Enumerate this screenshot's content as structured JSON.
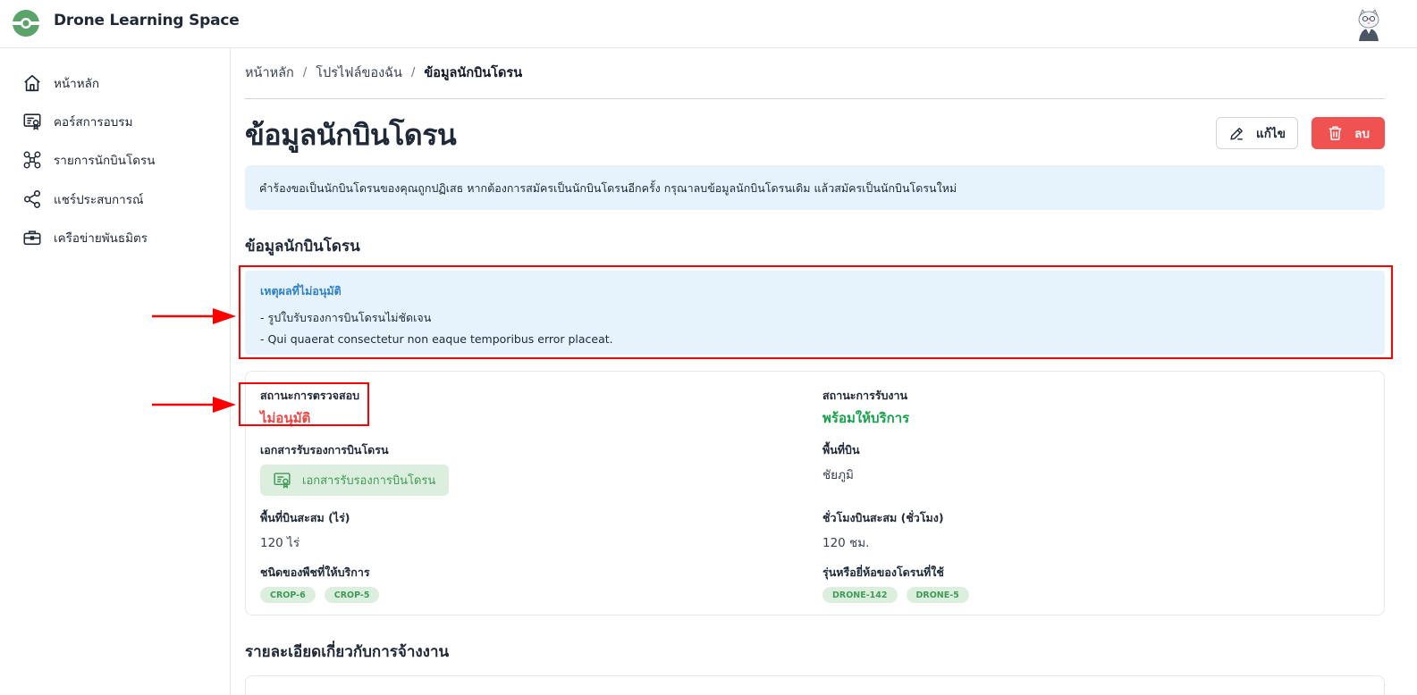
{
  "app": {
    "title": "Drone Learning Space"
  },
  "sidebar": {
    "items": [
      {
        "label": "หน้าหลัก",
        "icon": "home-icon"
      },
      {
        "label": "คอร์สการอบรม",
        "icon": "certificate-icon"
      },
      {
        "label": "รายการนักบินโดรน",
        "icon": "drone-icon"
      },
      {
        "label": "แชร์ประสบการณ์",
        "icon": "share-icon"
      },
      {
        "label": "เครือข่ายพันธมิตร",
        "icon": "briefcase-icon"
      }
    ]
  },
  "breadcrumb": {
    "items": [
      "หน้าหลัก",
      "โปรไฟล์ของฉัน"
    ],
    "separator": "/",
    "current": "ข้อมูลนักบินโดรน"
  },
  "page": {
    "title": "ข้อมูลนักบินโดรน",
    "edit_label": "แก้ไข",
    "delete_label": "ลบ",
    "alert": "คำร้องขอเป็นนักบินโดรนของคุณถูกปฏิเสธ หากต้องการสมัครเป็นนักบินโดรนอีกครั้ง กรุณาลบข้อมูลนักบินโดรนเดิม แล้วสมัครเป็นนักบินโดรนใหม่"
  },
  "section": {
    "pilot_info_title": "ข้อมูลนักบินโดรน",
    "employment_title": "รายละเอียดเกี่ยวกับการจ้างงาน"
  },
  "rejection": {
    "title": "เหตุผลที่ไม่อนุมัติ",
    "reasons": [
      "- รูปใบรับรองการบินโดรนไม่ชัดเจน",
      "- Qui quaerat consectetur non eaque temporibus error placeat."
    ]
  },
  "details": {
    "verification_status": {
      "label": "สถานะการตรวจสอบ",
      "value": "ไม่อนุมัติ"
    },
    "work_status": {
      "label": "สถานะการรับงาน",
      "value": "พร้อมให้บริการ"
    },
    "certificate": {
      "label": "เอกสารรับรองการบินโดรน",
      "button": "เอกสารรับรองการบินโดรน"
    },
    "flight_area": {
      "label": "พื้นที่บิน",
      "value": "ชัยภูมิ"
    },
    "accumulated_area": {
      "label": "พื้นที่บินสะสม (ไร่)",
      "value": "120 ไร่"
    },
    "accumulated_hours": {
      "label": "ชั่วโมงบินสะสม (ชั่วโมง)",
      "value": "120 ชม."
    },
    "crop_types": {
      "label": "ชนิดของพืชที่ให้บริการ",
      "chips": [
        "CROP-6",
        "CROP-5"
      ]
    },
    "drone_models": {
      "label": "รุ่นหรือยี่ห้อของโดรนที่ใช้",
      "chips": [
        "DRONE-142",
        "DRONE-5"
      ]
    }
  },
  "colors": {
    "brand_green": "#3f9b55",
    "danger": "#f05252",
    "info_bg": "#e6f3fc",
    "annotation": "#ff0000"
  }
}
